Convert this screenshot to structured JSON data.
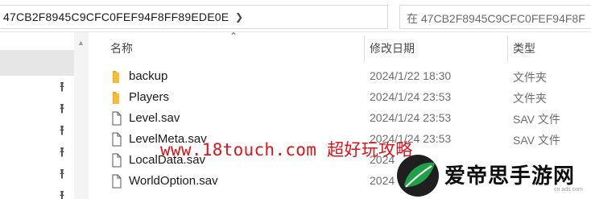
{
  "address_bar": {
    "path": "47CB2F8945C9CFC0FEF94F8FF89EDE0E",
    "chevron_icon": "chevron-right-icon"
  },
  "search": {
    "placeholder": "在 47CB2F8945C9CFC0FEF94F8F"
  },
  "nav_pane": {
    "pin_icon": "pin-icon",
    "pins_count": 6
  },
  "columns": {
    "name": "名称",
    "date_modified": "修改日期",
    "type": "类型"
  },
  "files": [
    {
      "name": "backup",
      "date": "2024/1/22 18:30",
      "type": "文件夹",
      "icon": "folder-icon"
    },
    {
      "name": "Players",
      "date": "2024/1/24 23:53",
      "type": "文件夹",
      "icon": "folder-icon"
    },
    {
      "name": "Level.sav",
      "date": "2024/1/24 23:53",
      "type": "SAV 文件",
      "icon": "file-icon"
    },
    {
      "name": "LevelMeta.sav",
      "date": "2024/1/24 23:53",
      "type": "SAV 文件",
      "icon": "file-icon"
    },
    {
      "name": "LocalData.sav",
      "date": "2024",
      "type": "",
      "icon": "file-icon"
    },
    {
      "name": "WorldOption.sav",
      "date": "2024",
      "type": "",
      "icon": "file-icon"
    }
  ],
  "watermark": {
    "text": "www.18touch.com 超好玩攻略"
  },
  "logo": {
    "text": "爱帝思手游网",
    "subtext": "cn ads com"
  },
  "colors": {
    "folder": "#f4bd3a",
    "watermark": "#e0131a",
    "logo_green": "#21a04a"
  }
}
